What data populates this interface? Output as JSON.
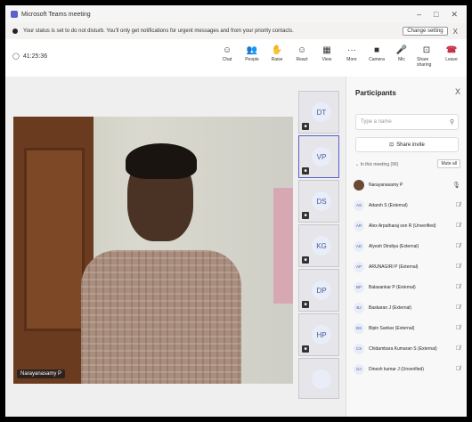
{
  "window": {
    "title": "Microsoft Teams meeting",
    "controls": [
      "–",
      "□",
      "✕"
    ]
  },
  "banner": {
    "text": "Your status is set to do not disturb. You'll only get notifications for urgent messages and from your priority contacts.",
    "change_label": "Change setting",
    "close": "X"
  },
  "toolbar": {
    "timer": "41:25:36",
    "buttons": [
      {
        "label": "Chat",
        "icon": "chat-icon",
        "glyph": "☺"
      },
      {
        "label": "People",
        "icon": "people-icon",
        "glyph": "👥"
      },
      {
        "label": "Raise",
        "icon": "raise-hand-icon",
        "glyph": "✋"
      },
      {
        "label": "React",
        "icon": "react-icon",
        "glyph": "☺"
      },
      {
        "label": "View",
        "icon": "view-icon",
        "glyph": "▦"
      },
      {
        "label": "More",
        "icon": "more-icon",
        "glyph": "···"
      },
      {
        "label": "Camera",
        "icon": "camera-icon",
        "glyph": "■"
      },
      {
        "label": "Mic",
        "icon": "mic-icon",
        "glyph": "🎤"
      },
      {
        "label": "Share sharing",
        "icon": "share-icon",
        "glyph": "⊡"
      },
      {
        "label": "Leave",
        "icon": "leave-icon",
        "glyph": "☎"
      }
    ]
  },
  "video": {
    "name": "Narayanasamy P"
  },
  "strip": [
    {
      "initials": "DT",
      "badge": "■"
    },
    {
      "initials": "VP",
      "badge": "■"
    },
    {
      "initials": "DS",
      "badge": "■"
    },
    {
      "initials": "KG",
      "badge": "■"
    },
    {
      "initials": "DP",
      "badge": "■"
    },
    {
      "initials": "HP",
      "badge": "■"
    },
    {
      "initials": "",
      "badge": ""
    }
  ],
  "participants": {
    "title": "Participants",
    "close": "X",
    "search_placeholder": "Type a name",
    "share_invite": "Share invite",
    "section": "In this meeting (96)",
    "mute_all": "Mute all",
    "list": [
      {
        "initials": "",
        "name": "Narayanasamy P",
        "photo": true
      },
      {
        "initials": "AS",
        "name": "Adarsh S (External)"
      },
      {
        "initials": "AR",
        "name": "Alex Arputharaj son R (Unverified)"
      },
      {
        "initials": "AD",
        "name": "Alyesh Dindiya (External)"
      },
      {
        "initials": "AP",
        "name": "ARUNAGIRI P (External)"
      },
      {
        "initials": "BP",
        "name": "Balasankar P (External)"
      },
      {
        "initials": "BJ",
        "name": "Baskaran J (External)"
      },
      {
        "initials": "BS",
        "name": "Bipin Sankar (External)"
      },
      {
        "initials": "CS",
        "name": "Chidambara Kumaran S (External)"
      },
      {
        "initials": "DJ",
        "name": "Dinesh kumar J (Unverified)"
      }
    ]
  }
}
